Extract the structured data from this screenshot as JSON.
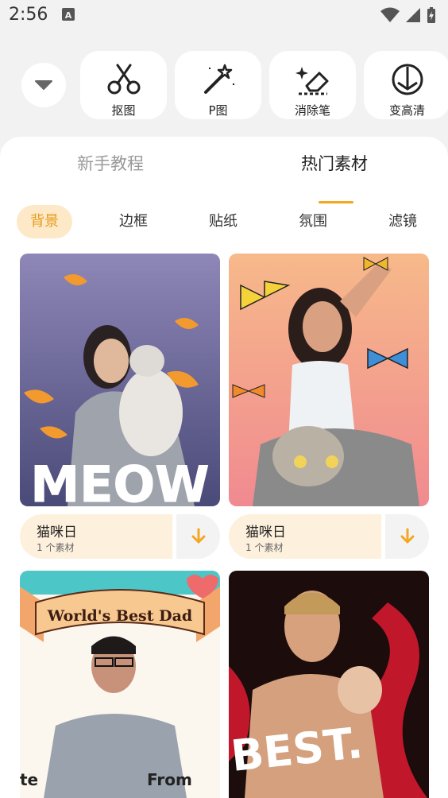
{
  "status_bar": {
    "time": "2:56",
    "notif_glyph": "A",
    "icons": [
      "wifi-icon",
      "signal-icon",
      "battery-charging-icon"
    ]
  },
  "tools": [
    {
      "label": "抠图",
      "icon": "scissors-icon"
    },
    {
      "label": "P图",
      "icon": "magic-wand-icon"
    },
    {
      "label": "消除笔",
      "icon": "eraser-icon"
    },
    {
      "label": "变高清",
      "icon": "hd-enhance-icon"
    }
  ],
  "tabs": {
    "beginner": "新手教程",
    "hot": "热门素材",
    "active": "hot"
  },
  "chips": [
    "背景",
    "边框",
    "贴纸",
    "氛围",
    "滤镜"
  ],
  "active_chip": "背景",
  "cards": [
    {
      "title": "猫咪日",
      "count": "1 个素材",
      "image_text": "MEOW"
    },
    {
      "title": "猫咪日",
      "count": "1 个素材"
    },
    {
      "image_text": "World's Best Dad",
      "image_text_bottom_left": "te",
      "image_text_bottom_right": "From"
    },
    {
      "image_text": "BEST."
    }
  ],
  "colors": {
    "accent": "#f5a623",
    "chip_bg": "#fde9c8",
    "info_bg": "#fdf0dc"
  }
}
